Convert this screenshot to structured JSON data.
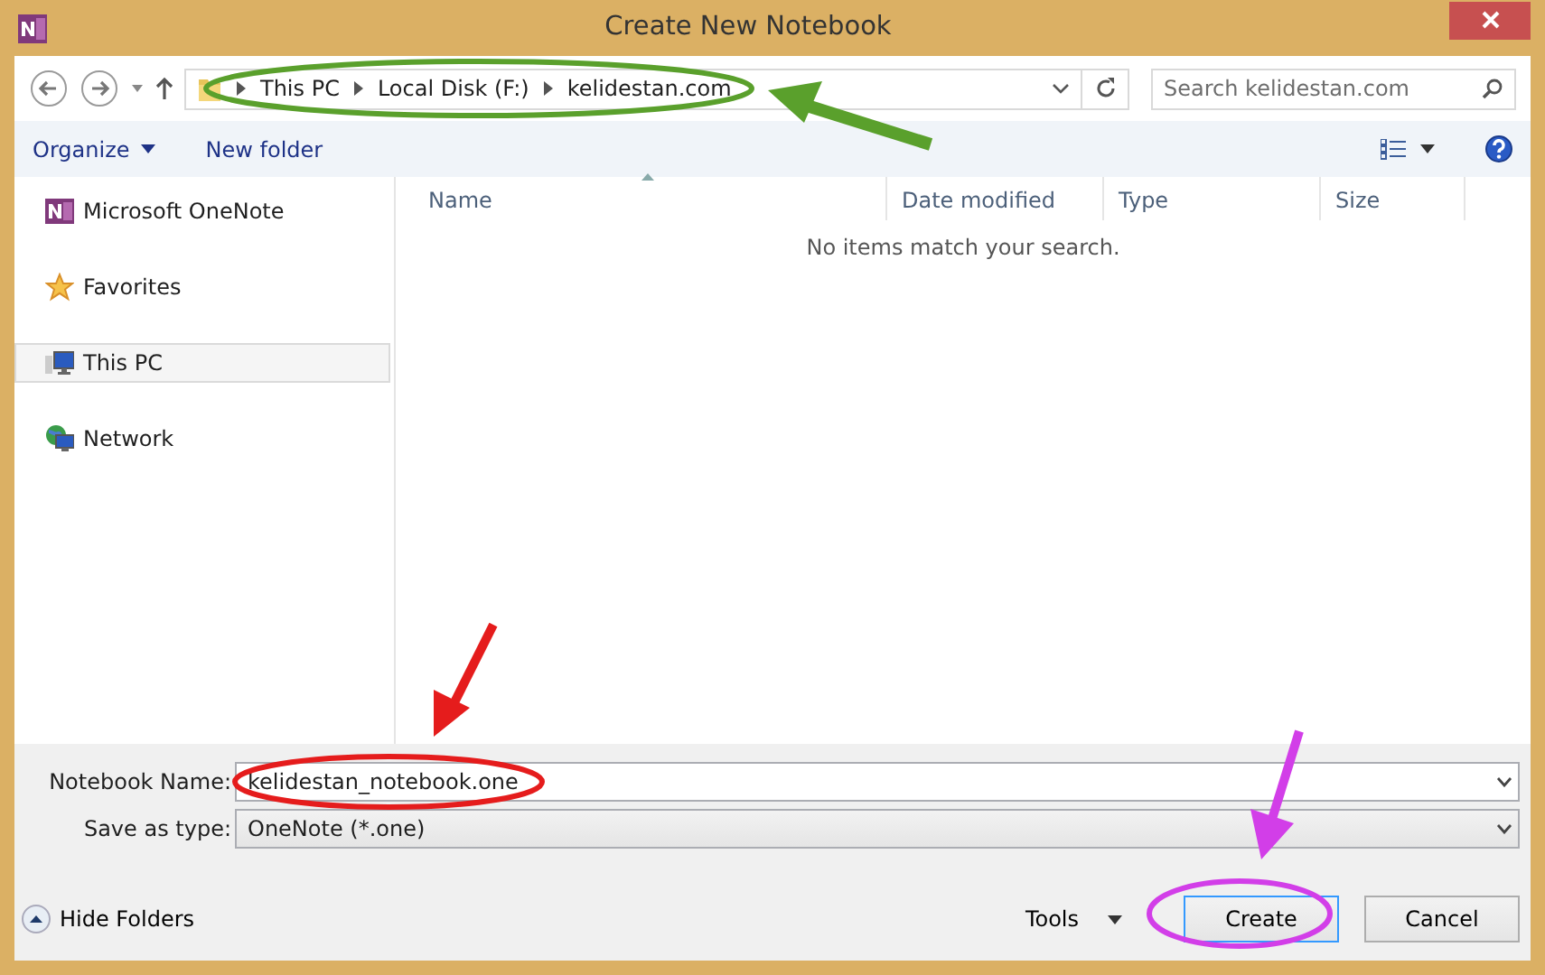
{
  "window": {
    "title": "Create New Notebook"
  },
  "navigation": {
    "path": [
      "This PC",
      "Local Disk (F:)",
      "kelidestan.com"
    ],
    "search": {
      "placeholder": "Search kelidestan.com"
    }
  },
  "toolbar": {
    "buttons": [
      {
        "label": "Organize",
        "kind": "menu"
      },
      {
        "label": "New folder",
        "kind": "plain"
      }
    ]
  },
  "sidebar": {
    "items": [
      {
        "label": "Microsoft OneNote",
        "kind": "onenote",
        "selected": false
      },
      {
        "label": "Favorites",
        "kind": "star",
        "selected": false
      },
      {
        "label": "This PC",
        "kind": "computer",
        "selected": true
      },
      {
        "label": "Network",
        "kind": "network",
        "selected": false
      }
    ]
  },
  "file_list": {
    "columns": [
      {
        "label": "Name",
        "sorted": true
      },
      {
        "label": "Date modified",
        "sorted": false
      },
      {
        "label": "Type",
        "sorted": false
      },
      {
        "label": "Size",
        "sorted": false
      }
    ],
    "empty_message": "No items match your search."
  },
  "form": {
    "fields": [
      {
        "label": "Notebook Name:",
        "kind": "input",
        "value": "kelidestan_notebook.one"
      },
      {
        "label": "Save as type:",
        "kind": "select",
        "value": "OneNote (*.one)"
      }
    ]
  },
  "footer": {
    "hide_folders": "Hide Folders",
    "tools": "Tools",
    "buttons": [
      {
        "label": "Create",
        "default": true
      },
      {
        "label": "Cancel",
        "default": false
      }
    ]
  }
}
